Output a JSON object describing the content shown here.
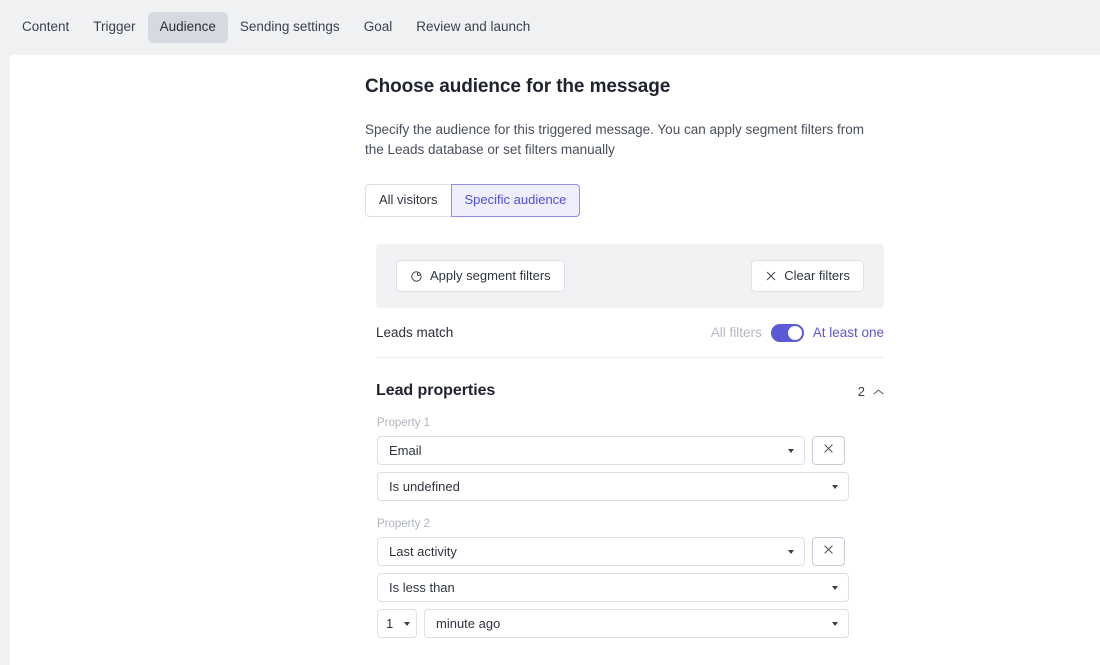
{
  "nav": {
    "tabs": [
      {
        "label": "Content",
        "active": false
      },
      {
        "label": "Trigger",
        "active": false
      },
      {
        "label": "Audience",
        "active": true
      },
      {
        "label": "Sending settings",
        "active": false
      },
      {
        "label": "Goal",
        "active": false
      },
      {
        "label": "Review and launch",
        "active": false
      }
    ]
  },
  "main": {
    "title": "Choose audience for the message",
    "description": "Specify the audience for this triggered message. You can apply segment filters from the Leads database or set filters manually",
    "audience_toggle": {
      "options": [
        "All visitors",
        "Specific audience"
      ],
      "selected": "Specific audience"
    },
    "filter_bar": {
      "apply_label": "Apply segment filters",
      "clear_label": "Clear filters"
    },
    "match_row": {
      "label": "Leads match",
      "off_label": "All filters",
      "on_label": "At least one",
      "enabled": true
    },
    "section": {
      "title": "Lead properties",
      "count": "2",
      "properties": [
        {
          "label": "Property 1",
          "field": "Email",
          "operator": "Is undefined"
        },
        {
          "label": "Property 2",
          "field": "Last activity",
          "operator": "Is less than",
          "amount": "1",
          "unit": "minute ago"
        }
      ]
    }
  },
  "colors": {
    "accent": "#5a5ad6",
    "page_bg": "#f0f1f3",
    "bar_bg": "#f1f2f4",
    "selected_tab_bg": "#d6d9e0"
  }
}
